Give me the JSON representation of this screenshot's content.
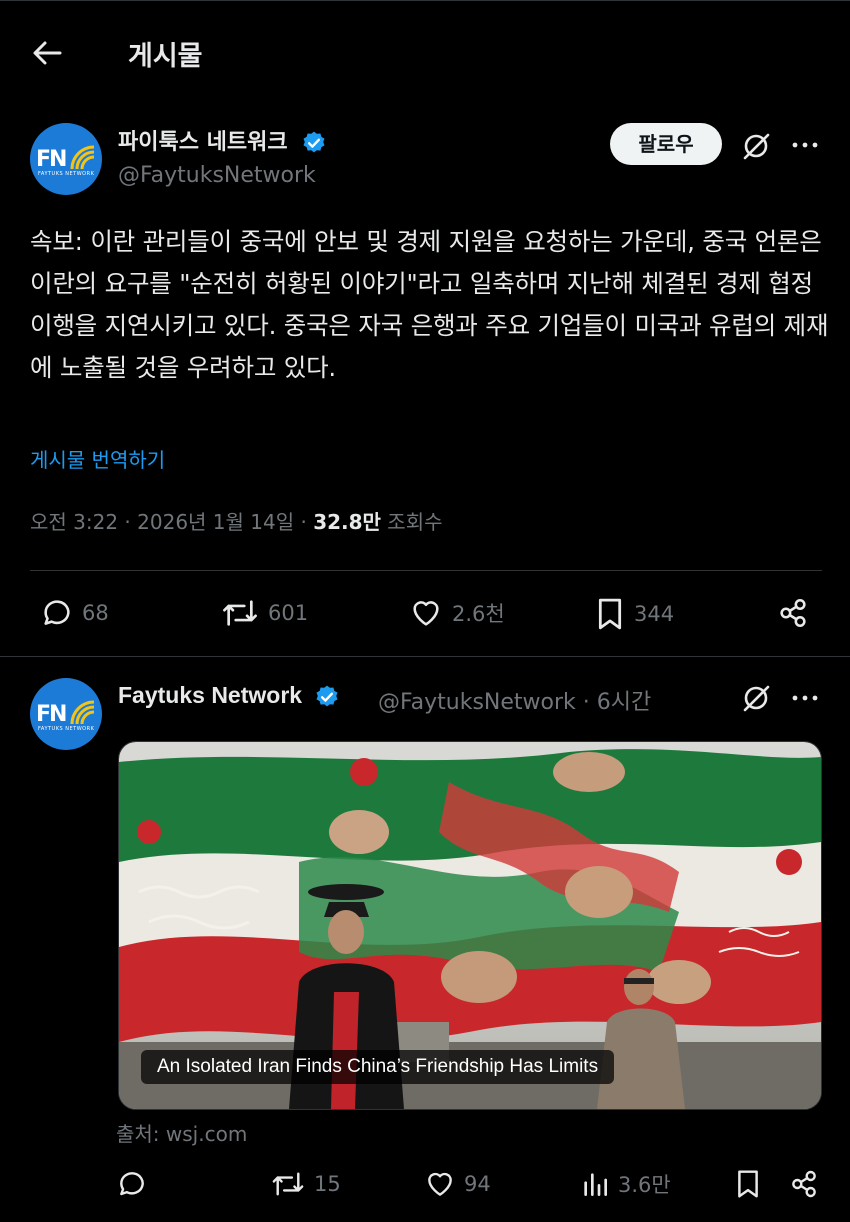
{
  "header": {
    "title": "게시물",
    "back_icon": "arrow-left-icon"
  },
  "post": {
    "author_name": "파이툭스 네트워크",
    "author_handle": "@FaytuksNetwork",
    "avatar_text": "FN",
    "avatar_subtext": "FAYTUKS NETWORK",
    "follow_label": "팔로우",
    "text": "속보: 이란 관리들이 중국에 안보 및 경제 지원을 요청하는 가운데, 중국 언론은 이란의 요구를 \"순전히 허황된 이야기\"라고 일축하며 지난해 체결된 경제 협정 이행을 지연시키고 있다. 중국은 자국 은행과 주요 기업들이 미국과 유럽의 제재에 노출될 것을 우려하고 있다.",
    "translate_label": "게시물 번역하기",
    "timestamp": "오전 3:22 · 2026년 1월 14일 · ",
    "views_count": "32.8만",
    "views_label": " 조회수",
    "replies": "68",
    "reposts": "601",
    "likes": "2.6천",
    "bookmarks": "344"
  },
  "quoted": {
    "author_name": "Faytuks Network",
    "author_handle": "@FaytuksNetwork",
    "time": " · 6시간",
    "card_caption": "An Isolated Iran Finds China’s Friendship Has Limits",
    "source": "출처: wsj.com",
    "replies": "",
    "reposts": "15",
    "likes": "94",
    "views": "3.6만"
  },
  "colors": {
    "accent": "#1d9bf0",
    "background": "#000000",
    "text": "#e7e9ea",
    "muted": "#71767b",
    "avatar": "#1d7bd8"
  }
}
